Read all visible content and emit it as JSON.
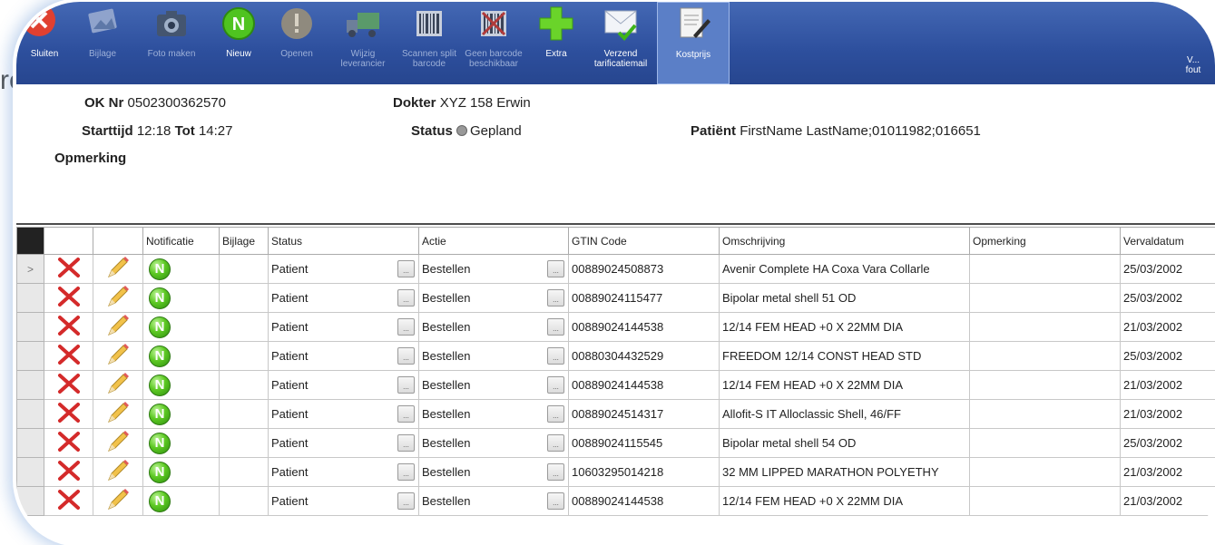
{
  "background_text": "re",
  "toolbar": {
    "buttons": [
      {
        "label": "Sluiten",
        "icon": "close-circle-icon"
      },
      {
        "label": "Bijlage",
        "icon": "picture-icon"
      },
      {
        "label": "Foto maken",
        "icon": "camera-icon"
      },
      {
        "label": "Nieuw",
        "icon": "new-n-icon"
      },
      {
        "label": "Openen",
        "icon": "open-exclamation-icon"
      },
      {
        "label": "Wijzig leverancier",
        "icon": "truck-icon"
      },
      {
        "label": "Scannen split barcode",
        "icon": "barcode-icon"
      },
      {
        "label": "Geen barcode beschikbaar",
        "icon": "barcode-crossed-icon"
      },
      {
        "label": "Extra",
        "icon": "plus-icon"
      },
      {
        "label": "Verzend tarificatiemail",
        "icon": "envelope-check-icon"
      },
      {
        "label": "Kostprijs",
        "icon": "document-pen-icon"
      },
      {
        "label": "V... fout",
        "icon": "cut-off-icon"
      }
    ]
  },
  "header": {
    "ok_nr_label": "OK Nr",
    "ok_nr": "0502300362570",
    "dokter_label": "Dokter",
    "dokter": "XYZ 158 Erwin",
    "starttijd_label": "Starttijd",
    "starttijd": "12:18",
    "tot_label": "Tot",
    "tot": "14:27",
    "status_label": "Status",
    "status": "Gepland",
    "patient_label": "Patiënt",
    "patient": "FirstName LastName;01011982;016651",
    "opmerking_label": "Opmerking"
  },
  "grid": {
    "columns": [
      "",
      "",
      "",
      "Notificatie",
      "Bijlage",
      "Status",
      "Actie",
      "GTIN Code",
      "Omschrijving",
      "Opmerking",
      "Vervaldatum"
    ],
    "current_row_marker": ">",
    "ellipsis": "...",
    "rows": [
      {
        "status": "Patient",
        "actie": "Bestellen",
        "gtin": "00889024508873",
        "omschrijving": "Avenir Complete HA Coxa Vara Collarle",
        "opmerking": "",
        "vervaldatum": "25/03/2002"
      },
      {
        "status": "Patient",
        "actie": "Bestellen",
        "gtin": "00889024115477",
        "omschrijving": "Bipolar metal shell 51 OD",
        "opmerking": "",
        "vervaldatum": "25/03/2002"
      },
      {
        "status": "Patient",
        "actie": "Bestellen",
        "gtin": "00889024144538",
        "omschrijving": "12/14 FEM HEAD +0 X 22MM DIA",
        "opmerking": "",
        "vervaldatum": "21/03/2002"
      },
      {
        "status": "Patient",
        "actie": "Bestellen",
        "gtin": "00880304432529",
        "omschrijving": "FREEDOM 12/14 CONST HEAD STD",
        "opmerking": "",
        "vervaldatum": "25/03/2002"
      },
      {
        "status": "Patient",
        "actie": "Bestellen",
        "gtin": "00889024144538",
        "omschrijving": "12/14 FEM HEAD +0 X 22MM DIA",
        "opmerking": "",
        "vervaldatum": "21/03/2002"
      },
      {
        "status": "Patient",
        "actie": "Bestellen",
        "gtin": "00889024514317",
        "omschrijving": "Allofit-S IT Alloclassic Shell,  46/FF",
        "opmerking": "",
        "vervaldatum": "21/03/2002"
      },
      {
        "status": "Patient",
        "actie": "Bestellen",
        "gtin": "00889024115545",
        "omschrijving": "Bipolar metal shell 54 OD",
        "opmerking": "",
        "vervaldatum": "25/03/2002"
      },
      {
        "status": "Patient",
        "actie": "Bestellen",
        "gtin": "10603295014218",
        "omschrijving": "32 MM LIPPED MARATHON POLYETHY",
        "opmerking": "",
        "vervaldatum": "21/03/2002"
      },
      {
        "status": "Patient",
        "actie": "Bestellen",
        "gtin": "00889024144538",
        "omschrijving": "12/14 FEM HEAD +0 X 22MM DIA",
        "opmerking": "",
        "vervaldatum": "21/03/2002"
      }
    ]
  }
}
